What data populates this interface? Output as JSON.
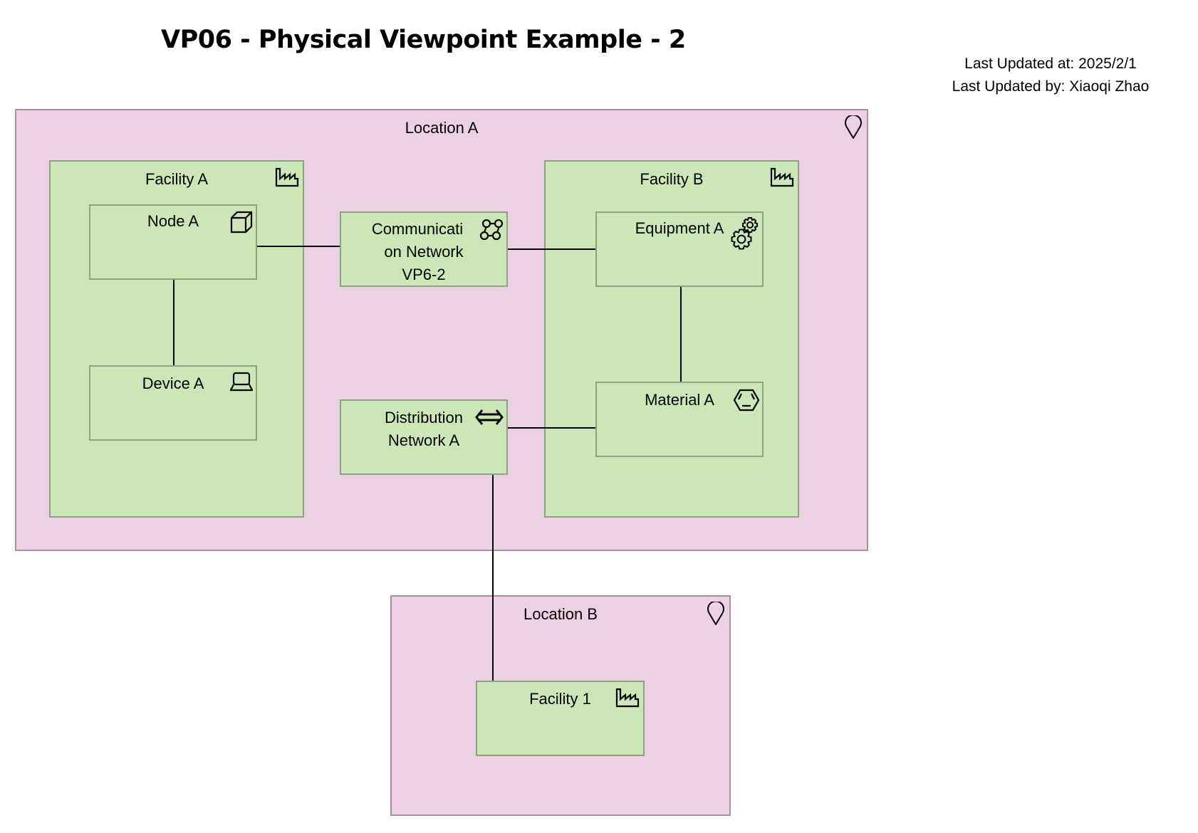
{
  "header": {
    "title": "VP06 - Physical Viewpoint Example - 2",
    "last_updated_at": "Last Updated at: 2025/2/1",
    "last_updated_by": "Last Updated by: Xiaoqi Zhao"
  },
  "colors": {
    "location_fill": "#ecd0e3",
    "location_border": "#a6909f",
    "physical_fill": "#cce6b7",
    "physical_border": "#8da382",
    "connector": "#000000"
  },
  "elements": {
    "location_a": {
      "label": "Location A",
      "type": "location",
      "icon": "location-pin-icon"
    },
    "facility_a": {
      "label": "Facility A",
      "type": "facility",
      "icon": "factory-icon"
    },
    "node_a": {
      "label": "Node A",
      "type": "node",
      "icon": "node-cube-icon"
    },
    "device_a": {
      "label": "Device A",
      "type": "device",
      "icon": "device-icon"
    },
    "comm_network": {
      "label_lines": [
        "Communicati",
        "on Network",
        "VP6-2"
      ],
      "type": "communication-network",
      "icon": "network-icon"
    },
    "dist_network": {
      "label_lines": [
        "Distribution",
        "Network A"
      ],
      "type": "distribution-network",
      "icon": "bidirectional-arrow-icon"
    },
    "facility_b": {
      "label": "Facility B",
      "type": "facility",
      "icon": "factory-icon"
    },
    "equipment_a": {
      "label": "Equipment A",
      "type": "equipment",
      "icon": "gears-icon"
    },
    "material_a": {
      "label": "Material A",
      "type": "material",
      "icon": "hexagon-material-icon"
    },
    "location_b": {
      "label": "Location B",
      "type": "location",
      "icon": "location-pin-icon"
    },
    "facility_1": {
      "label": "Facility 1",
      "type": "facility",
      "icon": "factory-icon"
    }
  },
  "connections": [
    {
      "from": "Node A",
      "to": "Device A"
    },
    {
      "from": "Node A",
      "to": "Communication Network VP6-2"
    },
    {
      "from": "Communication Network VP6-2",
      "to": "Equipment A"
    },
    {
      "from": "Equipment A",
      "to": "Material A"
    },
    {
      "from": "Distribution Network A",
      "to": "Material A"
    },
    {
      "from": "Distribution Network A",
      "to": "Facility 1"
    }
  ]
}
